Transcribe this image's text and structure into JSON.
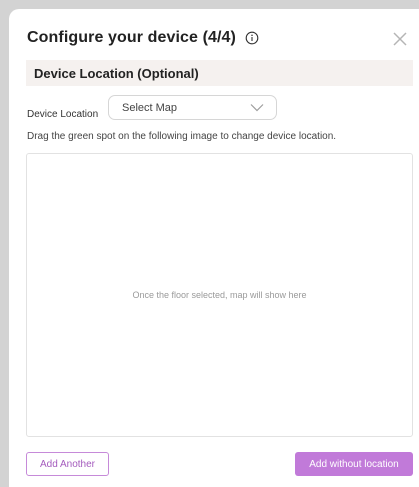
{
  "dialog": {
    "title": "Configure your device (4/4)",
    "section_title": "Device Location (Optional)",
    "location_label": "Device Location",
    "select": {
      "value": "Select Map"
    },
    "hint": "Drag the green spot on the following image to change device location.",
    "map_placeholder": "Once the floor selected, map will show here",
    "buttons": {
      "add_another": "Add Another",
      "add_without_location": "Add without location"
    }
  },
  "icons": {
    "info": "info-icon",
    "close": "close-icon",
    "chevron": "chevron-down-icon"
  },
  "colors": {
    "accent": "#c17ad9",
    "accent_text": "#a45bbd",
    "section_bg": "#f5f1ef"
  }
}
